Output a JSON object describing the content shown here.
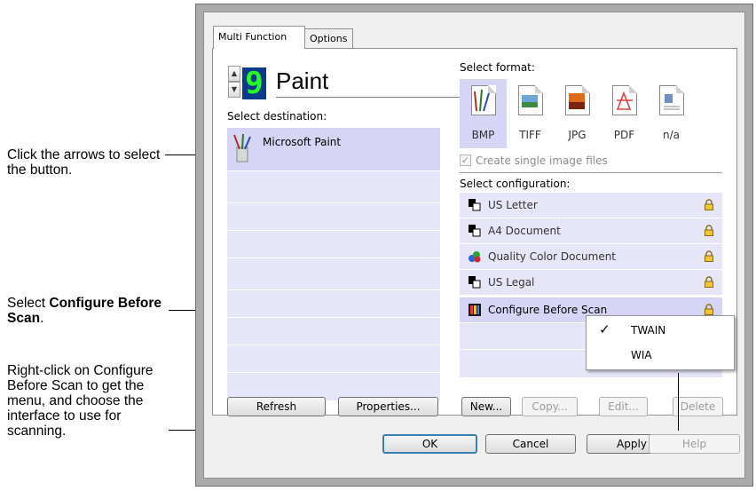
{
  "annotations": {
    "arrows": "Click the arrows to select the button.",
    "configure_prefix": "Select ",
    "configure_bold": "Configure Before Scan",
    "configure_suffix": ".",
    "rightclick": "Right-click on Configure Before Scan to get the menu, and choose the interface to use for scanning."
  },
  "tabs": [
    "Multi Function",
    "Options"
  ],
  "button_display": {
    "number": "9",
    "name": "Paint"
  },
  "destination": {
    "label": "Select destination:",
    "items": [
      "Microsoft Paint"
    ],
    "buttons": {
      "refresh": "Refresh",
      "properties": "Properties..."
    }
  },
  "format": {
    "label": "Select format:",
    "items": [
      {
        "label": "BMP",
        "icon": "bmp-file-icon",
        "selected": true
      },
      {
        "label": "TIFF",
        "icon": "tiff-file-icon",
        "selected": false
      },
      {
        "label": "JPG",
        "icon": "jpg-file-icon",
        "selected": false
      },
      {
        "label": "PDF",
        "icon": "pdf-file-icon",
        "selected": false
      },
      {
        "label": "n/a",
        "icon": "na-file-icon",
        "selected": false
      }
    ],
    "single_files_label": "Create single image files",
    "single_files_checked": true
  },
  "configuration": {
    "label": "Select configuration:",
    "items": [
      {
        "label": "US Letter",
        "locked": true
      },
      {
        "label": "A4 Document",
        "locked": true
      },
      {
        "label": "Quality Color Document",
        "locked": true
      },
      {
        "label": "US Legal",
        "locked": true
      },
      {
        "label": "Configure Before Scan",
        "locked": true,
        "selected": true
      }
    ],
    "buttons": {
      "new": "New...",
      "copy": "Copy...",
      "edit": "Edit...",
      "delete": "Delete"
    }
  },
  "context_menu": {
    "items": [
      "TWAIN",
      "WIA"
    ],
    "checked": "TWAIN"
  },
  "dialog_buttons": {
    "ok": "OK",
    "cancel": "Cancel",
    "apply": "Apply",
    "help": "Help"
  },
  "colors": {
    "selection": "#d6d5f6",
    "row": "#e7e6f9",
    "digit_bg": "#0b3a8a",
    "digit_fg": "#22ff22"
  }
}
